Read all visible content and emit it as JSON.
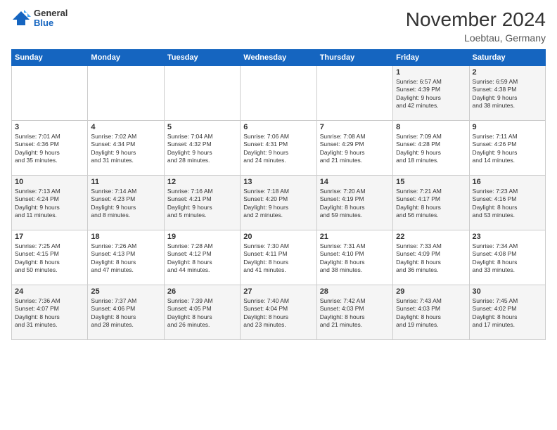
{
  "header": {
    "logo_general": "General",
    "logo_blue": "Blue",
    "month_title": "November 2024",
    "location": "Loebtau, Germany"
  },
  "days_of_week": [
    "Sunday",
    "Monday",
    "Tuesday",
    "Wednesday",
    "Thursday",
    "Friday",
    "Saturday"
  ],
  "weeks": [
    [
      {
        "day": "",
        "info": ""
      },
      {
        "day": "",
        "info": ""
      },
      {
        "day": "",
        "info": ""
      },
      {
        "day": "",
        "info": ""
      },
      {
        "day": "",
        "info": ""
      },
      {
        "day": "1",
        "info": "Sunrise: 6:57 AM\nSunset: 4:39 PM\nDaylight: 9 hours\nand 42 minutes."
      },
      {
        "day": "2",
        "info": "Sunrise: 6:59 AM\nSunset: 4:38 PM\nDaylight: 9 hours\nand 38 minutes."
      }
    ],
    [
      {
        "day": "3",
        "info": "Sunrise: 7:01 AM\nSunset: 4:36 PM\nDaylight: 9 hours\nand 35 minutes."
      },
      {
        "day": "4",
        "info": "Sunrise: 7:02 AM\nSunset: 4:34 PM\nDaylight: 9 hours\nand 31 minutes."
      },
      {
        "day": "5",
        "info": "Sunrise: 7:04 AM\nSunset: 4:32 PM\nDaylight: 9 hours\nand 28 minutes."
      },
      {
        "day": "6",
        "info": "Sunrise: 7:06 AM\nSunset: 4:31 PM\nDaylight: 9 hours\nand 24 minutes."
      },
      {
        "day": "7",
        "info": "Sunrise: 7:08 AM\nSunset: 4:29 PM\nDaylight: 9 hours\nand 21 minutes."
      },
      {
        "day": "8",
        "info": "Sunrise: 7:09 AM\nSunset: 4:28 PM\nDaylight: 9 hours\nand 18 minutes."
      },
      {
        "day": "9",
        "info": "Sunrise: 7:11 AM\nSunset: 4:26 PM\nDaylight: 9 hours\nand 14 minutes."
      }
    ],
    [
      {
        "day": "10",
        "info": "Sunrise: 7:13 AM\nSunset: 4:24 PM\nDaylight: 9 hours\nand 11 minutes."
      },
      {
        "day": "11",
        "info": "Sunrise: 7:14 AM\nSunset: 4:23 PM\nDaylight: 9 hours\nand 8 minutes."
      },
      {
        "day": "12",
        "info": "Sunrise: 7:16 AM\nSunset: 4:21 PM\nDaylight: 9 hours\nand 5 minutes."
      },
      {
        "day": "13",
        "info": "Sunrise: 7:18 AM\nSunset: 4:20 PM\nDaylight: 9 hours\nand 2 minutes."
      },
      {
        "day": "14",
        "info": "Sunrise: 7:20 AM\nSunset: 4:19 PM\nDaylight: 8 hours\nand 59 minutes."
      },
      {
        "day": "15",
        "info": "Sunrise: 7:21 AM\nSunset: 4:17 PM\nDaylight: 8 hours\nand 56 minutes."
      },
      {
        "day": "16",
        "info": "Sunrise: 7:23 AM\nSunset: 4:16 PM\nDaylight: 8 hours\nand 53 minutes."
      }
    ],
    [
      {
        "day": "17",
        "info": "Sunrise: 7:25 AM\nSunset: 4:15 PM\nDaylight: 8 hours\nand 50 minutes."
      },
      {
        "day": "18",
        "info": "Sunrise: 7:26 AM\nSunset: 4:13 PM\nDaylight: 8 hours\nand 47 minutes."
      },
      {
        "day": "19",
        "info": "Sunrise: 7:28 AM\nSunset: 4:12 PM\nDaylight: 8 hours\nand 44 minutes."
      },
      {
        "day": "20",
        "info": "Sunrise: 7:30 AM\nSunset: 4:11 PM\nDaylight: 8 hours\nand 41 minutes."
      },
      {
        "day": "21",
        "info": "Sunrise: 7:31 AM\nSunset: 4:10 PM\nDaylight: 8 hours\nand 38 minutes."
      },
      {
        "day": "22",
        "info": "Sunrise: 7:33 AM\nSunset: 4:09 PM\nDaylight: 8 hours\nand 36 minutes."
      },
      {
        "day": "23",
        "info": "Sunrise: 7:34 AM\nSunset: 4:08 PM\nDaylight: 8 hours\nand 33 minutes."
      }
    ],
    [
      {
        "day": "24",
        "info": "Sunrise: 7:36 AM\nSunset: 4:07 PM\nDaylight: 8 hours\nand 31 minutes."
      },
      {
        "day": "25",
        "info": "Sunrise: 7:37 AM\nSunset: 4:06 PM\nDaylight: 8 hours\nand 28 minutes."
      },
      {
        "day": "26",
        "info": "Sunrise: 7:39 AM\nSunset: 4:05 PM\nDaylight: 8 hours\nand 26 minutes."
      },
      {
        "day": "27",
        "info": "Sunrise: 7:40 AM\nSunset: 4:04 PM\nDaylight: 8 hours\nand 23 minutes."
      },
      {
        "day": "28",
        "info": "Sunrise: 7:42 AM\nSunset: 4:03 PM\nDaylight: 8 hours\nand 21 minutes."
      },
      {
        "day": "29",
        "info": "Sunrise: 7:43 AM\nSunset: 4:03 PM\nDaylight: 8 hours\nand 19 minutes."
      },
      {
        "day": "30",
        "info": "Sunrise: 7:45 AM\nSunset: 4:02 PM\nDaylight: 8 hours\nand 17 minutes."
      }
    ]
  ]
}
